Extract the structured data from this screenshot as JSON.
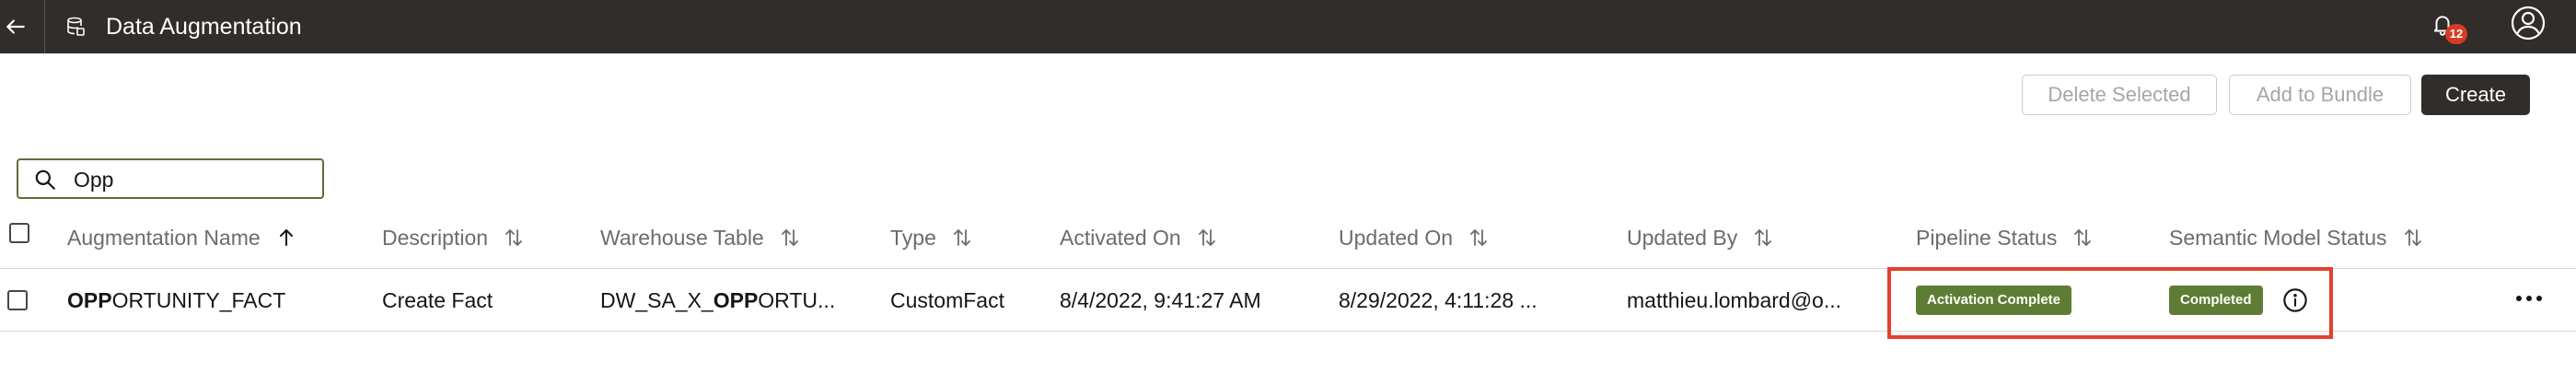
{
  "header": {
    "title": "Data Augmentation",
    "notification_count": "12",
    "icons": {
      "back": "arrow-left-icon",
      "app": "database-icon",
      "bell": "bell-icon",
      "user": "user-avatar-icon"
    }
  },
  "toolbar": {
    "delete_label": "Delete Selected",
    "bundle_label": "Add to Bundle",
    "create_label": "Create"
  },
  "search": {
    "value": "Opp",
    "placeholder": ""
  },
  "table": {
    "columns": [
      {
        "label": "Augmentation Name",
        "sort": "ascending"
      },
      {
        "label": "Description",
        "sort": "none"
      },
      {
        "label": "Warehouse Table",
        "sort": "none"
      },
      {
        "label": "Type",
        "sort": "none"
      },
      {
        "label": "Activated On",
        "sort": "none"
      },
      {
        "label": "Updated On",
        "sort": "none"
      },
      {
        "label": "Updated By",
        "sort": "none"
      },
      {
        "label": "Pipeline Status",
        "sort": "none"
      },
      {
        "label": "Semantic Model Status",
        "sort": "none"
      }
    ],
    "rows": [
      {
        "name_match": "OPP",
        "name_rest": "ORTUNITY_FACT",
        "description": "Create Fact",
        "warehouse_prefix": "DW_SA_X_",
        "warehouse_match": "OPP",
        "warehouse_rest": "ORTU...",
        "type": "CustomFact",
        "activated_on": "8/4/2022, 9:41:27 AM",
        "updated_on": "8/29/2022, 4:11:28 ...",
        "updated_by": "matthieu.lombard@o...",
        "pipeline_status": "Activation Complete",
        "semantic_model_status": "Completed"
      }
    ]
  },
  "colors": {
    "header_bg": "#312d2a",
    "status_green": "#5e7d34",
    "highlight_red": "#e3412f",
    "notification_red": "#d63b25"
  }
}
